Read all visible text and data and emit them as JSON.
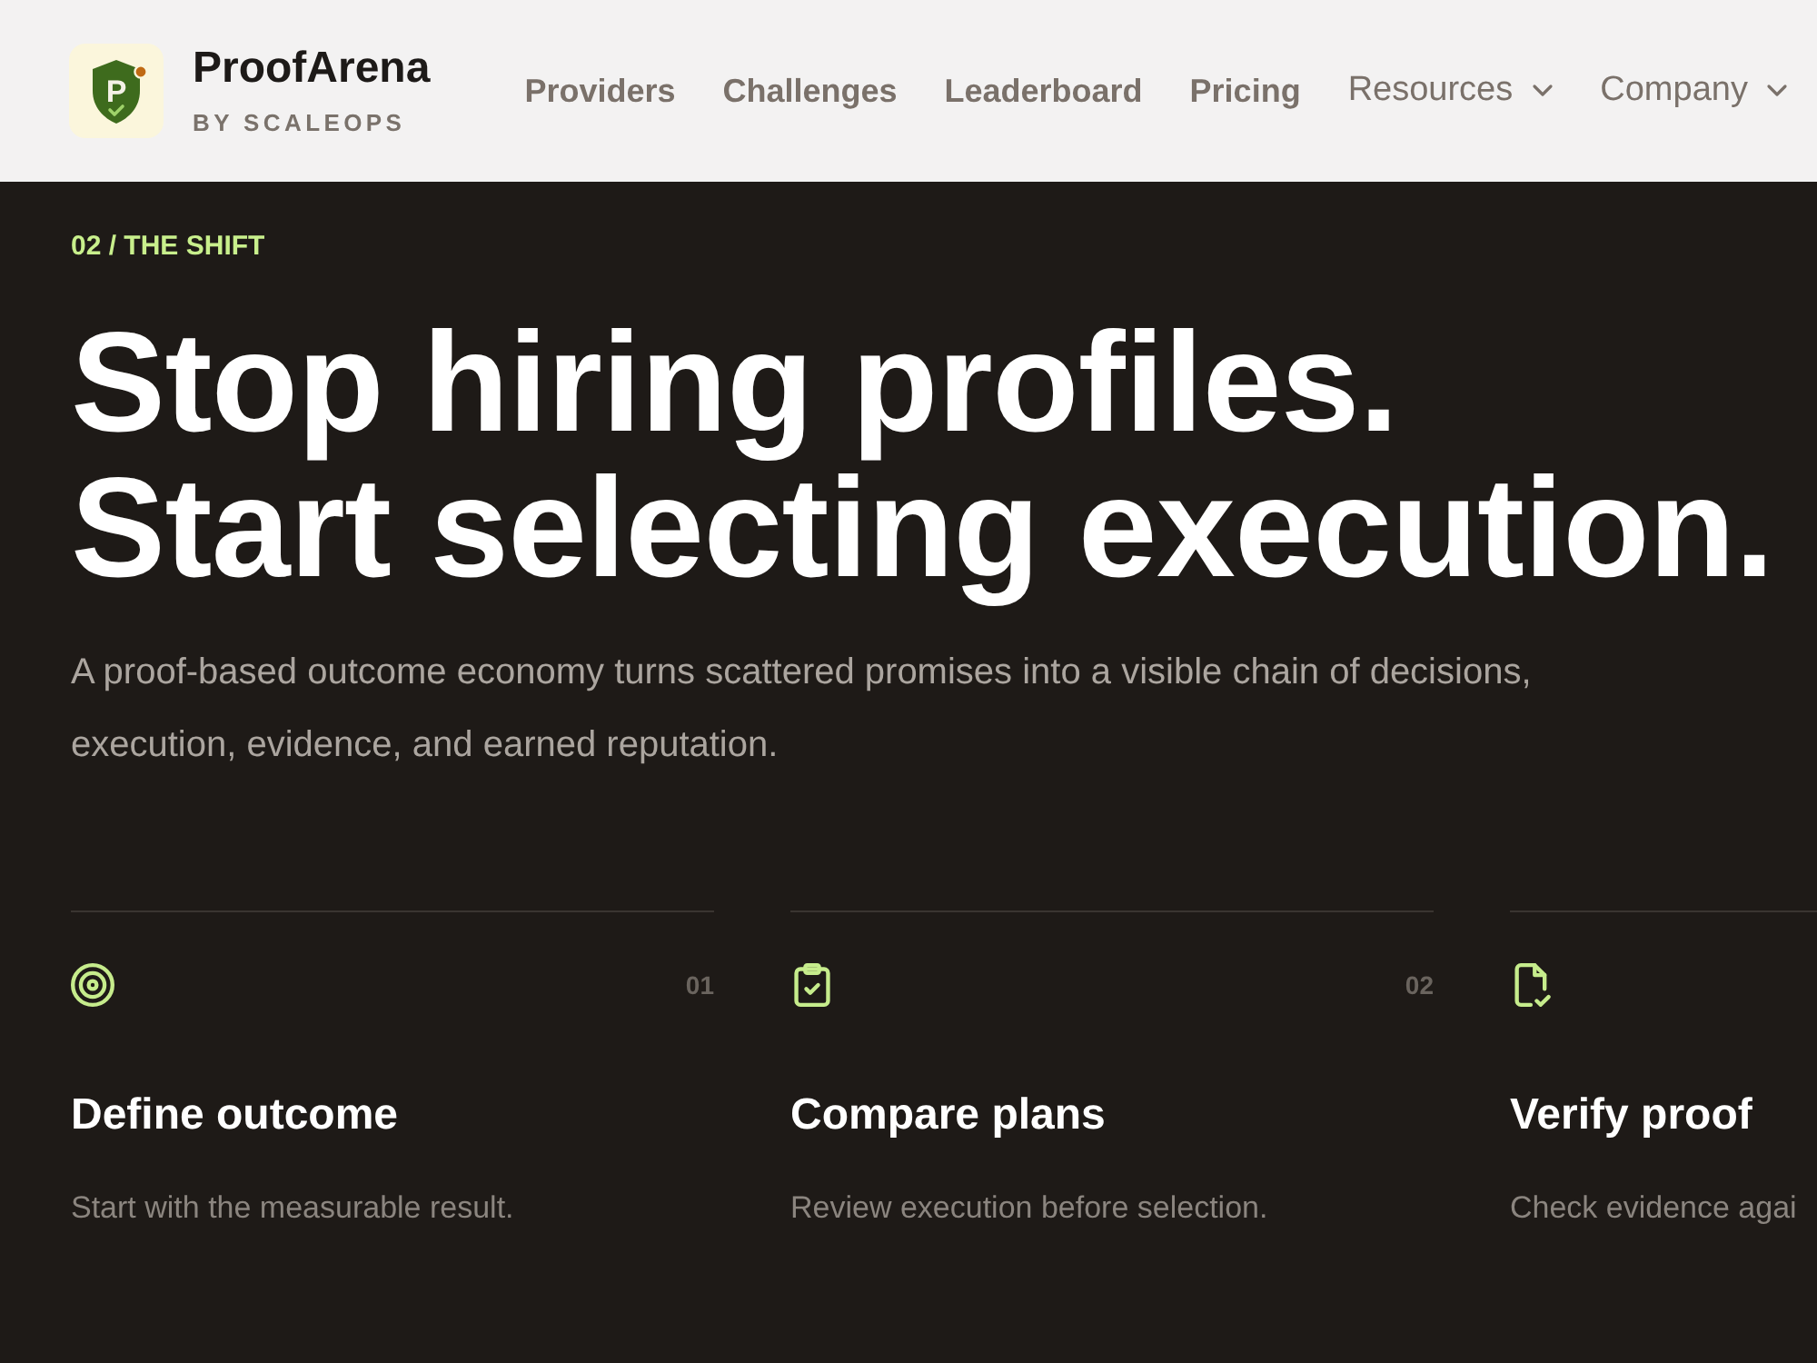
{
  "header": {
    "logo": {
      "mark": "P"
    },
    "brand": "ProofArena",
    "tagline": "BY SCALEOPS",
    "nav": [
      {
        "label": "Providers",
        "kind": "link"
      },
      {
        "label": "Challenges",
        "kind": "link"
      },
      {
        "label": "Leaderboard",
        "kind": "link"
      },
      {
        "label": "Pricing",
        "kind": "link"
      },
      {
        "label": "Resources",
        "kind": "dropdown"
      },
      {
        "label": "Company",
        "kind": "dropdown"
      }
    ]
  },
  "section": {
    "eyebrow": "02 / THE SHIFT",
    "headline": [
      "Stop hiring profiles.",
      "Start selecting execution."
    ],
    "lead": "A proof-based outcome economy turns scattered promises into a visible chain of decisions, execution, evidence, and earned reputation.",
    "steps": [
      {
        "kind": "target",
        "number": "01",
        "title": "Define outcome",
        "text": "Start with the measurable result."
      },
      {
        "kind": "clipboard",
        "number": "02",
        "title": "Compare plans",
        "text": "Review execution before selection."
      },
      {
        "kind": "file",
        "title": "Verify proof",
        "text": "Check evidence agai"
      }
    ]
  }
}
